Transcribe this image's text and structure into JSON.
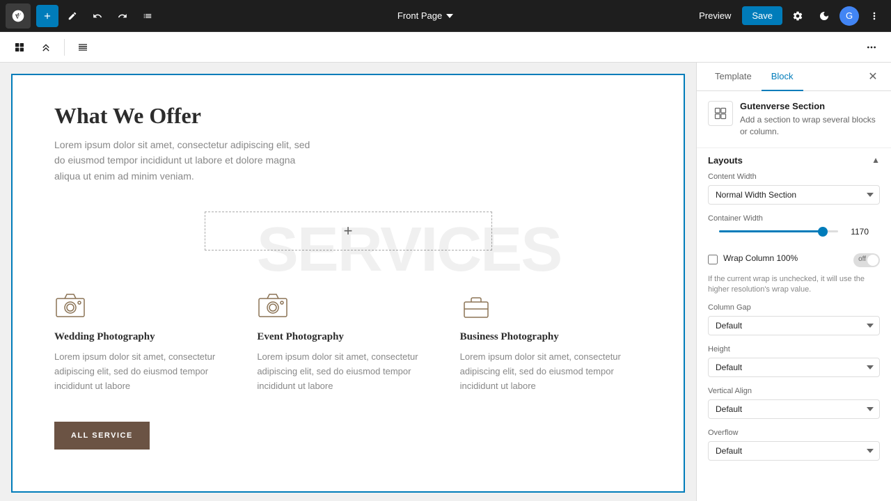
{
  "toolbar": {
    "page_title": "Front Page",
    "preview_label": "Preview",
    "save_label": "Save",
    "user_initial": "G"
  },
  "second_toolbar": {
    "layout_icon": "⊞",
    "arrows_icon": "⇅"
  },
  "canvas": {
    "watermark": "SERVICES",
    "section_title": "What We Offer",
    "section_subtitle": "Lorem ipsum dolor sit amet, consectetur adipiscing elit, sed do eiusmod tempor incididunt ut labore et dolore magna aliqua ut enim ad minim veniam.",
    "services": [
      {
        "name": "Wedding Photography",
        "description": "Lorem ipsum dolor sit amet, consectetur adipiscing elit, sed do eiusmod tempor incididunt ut labore"
      },
      {
        "name": "Event Photography",
        "description": "Lorem ipsum dolor sit amet, consectetur adipiscing elit, sed do eiusmod tempor incididunt ut labore"
      },
      {
        "name": "Business Photography",
        "description": "Lorem ipsum dolor sit amet, consectetur adipiscing elit, sed do eiusmod tempor incididunt ut labore"
      }
    ],
    "button_label": "ALL SERVICE"
  },
  "right_panel": {
    "tab_template": "Template",
    "tab_block": "Block",
    "block_name": "Gutenverse Section",
    "block_description": "Add a section to wrap several blocks or column.",
    "layouts_label": "Layouts",
    "content_width_label": "Content Width",
    "content_width_value": "Normal Width Section",
    "container_width_label": "Container Width",
    "container_width_value": "1170",
    "wrap_column_label": "Wrap Column 100%",
    "wrap_column_hint": "If the current wrap is unchecked, it will use the higher resolution's wrap value.",
    "wrap_off_label": "off",
    "column_gap_label": "Column Gap",
    "column_gap_value": "Default",
    "height_label": "Height",
    "height_value": "Default",
    "vertical_align_label": "Vertical Align",
    "vertical_align_value": "Default",
    "overflow_label": "Overflow",
    "overflow_value": "Default"
  }
}
